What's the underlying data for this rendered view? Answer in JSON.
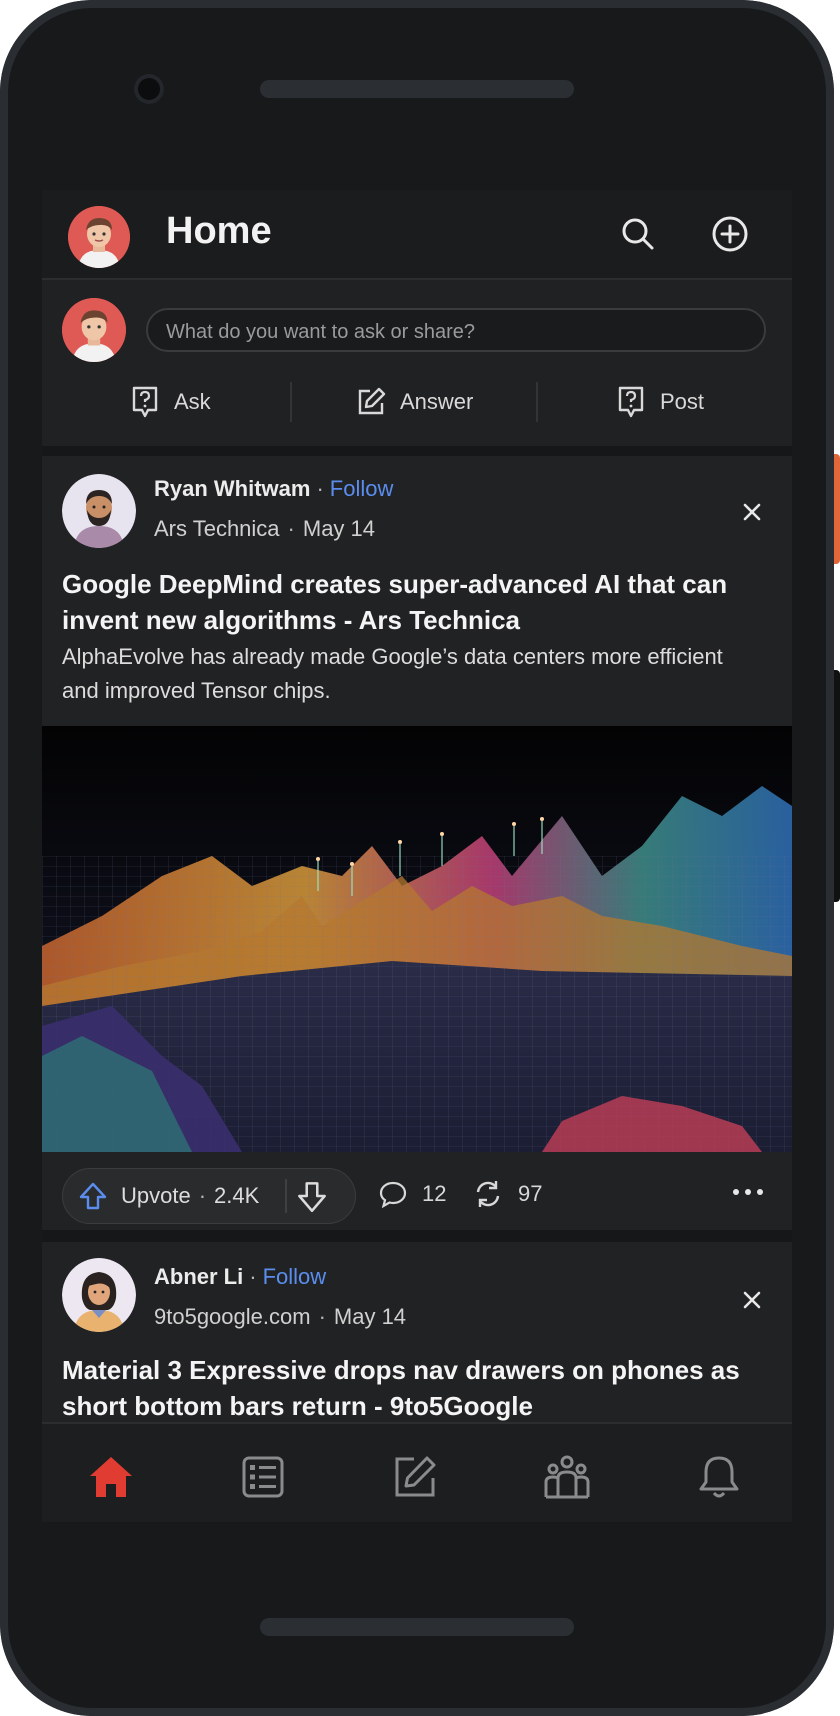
{
  "header": {
    "title": "Home"
  },
  "composer": {
    "placeholder": "What do you want to ask or share?",
    "actions": [
      {
        "label": "Ask"
      },
      {
        "label": "Answer"
      },
      {
        "label": "Post"
      }
    ]
  },
  "feed": [
    {
      "author": "Ryan Whitwam",
      "follow": "Follow",
      "source": "Ars Technica",
      "date": "May 14",
      "headline": "Google DeepMind creates super-advanced AI that can invent new algorithms - Ars Technica",
      "excerpt": "AlphaEvolve has already made Google’s data centers more efficient and improved Tensor chips.",
      "upvote_label": "Upvote",
      "upvotes": "2.4K",
      "comments": "12",
      "shares": "97"
    },
    {
      "author": "Abner Li",
      "follow": "Follow",
      "source": "9to5google.com",
      "date": "May 14",
      "headline": "Material 3 Expressive drops nav drawers on phones as short bottom bars return - 9to5Google"
    }
  ],
  "nav": {
    "items": [
      "home-icon",
      "following-icon",
      "answer-icon",
      "spaces-icon",
      "notifications-icon"
    ],
    "active_color": "#e03c31",
    "inactive_color": "#8a8b8c"
  },
  "colors": {
    "accent": "#5a8dee",
    "background": "#161718",
    "card": "#212223"
  }
}
